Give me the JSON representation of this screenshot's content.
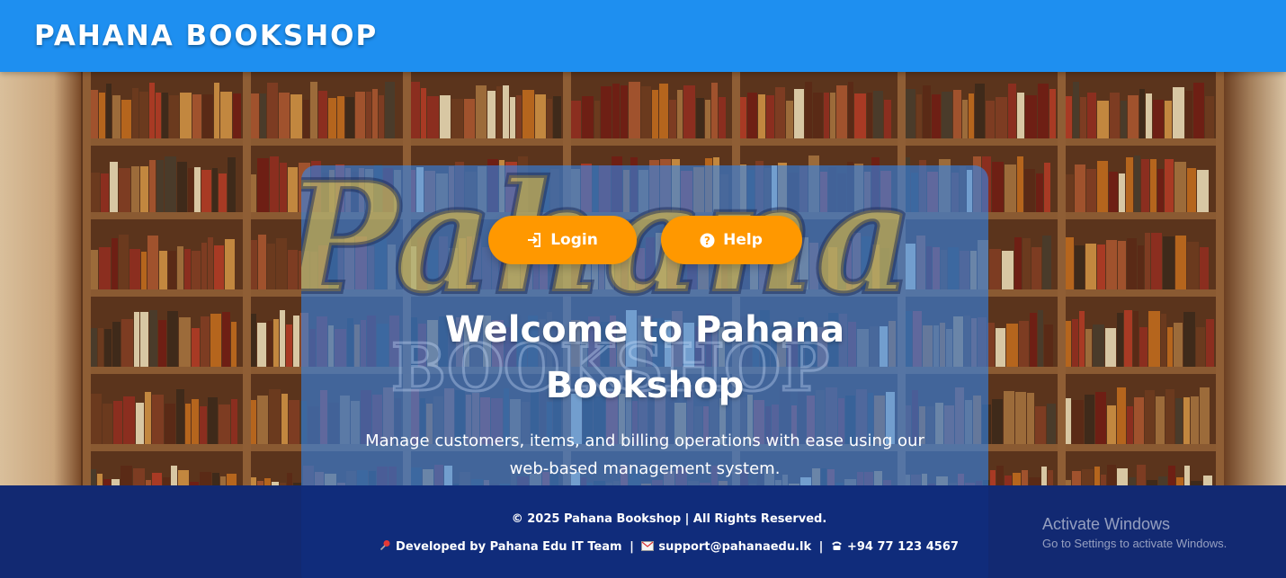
{
  "header": {
    "brand": "PAHANA BOOKSHOP"
  },
  "hero": {
    "logo_text": "Pahana",
    "logo_subtext": "BOOKSHOP",
    "actions": {
      "login_label": "Login",
      "help_label": "Help"
    },
    "title": "Welcome to Pahana Bookshop",
    "description": "Manage customers, items, and billing operations with ease using our web-based management system."
  },
  "footer": {
    "copyright": "© 2025 Pahana Bookshop | All Rights Reserved.",
    "developer": "Developed by Pahana Edu IT Team",
    "email": "support@pahanaedu.lk",
    "phone": "+94 77 123 4567",
    "separator": "|"
  },
  "watermark": {
    "title": "Activate Windows",
    "subtitle": "Go to Settings to activate Windows."
  },
  "colors": {
    "header_bg": "#1e8ff0",
    "button_accent": "#ff9800",
    "footer_bg": "#0c2878",
    "text": "#ffffff"
  },
  "icons": {
    "login": "sign-in-icon",
    "help": "question-circle-icon",
    "developer": "pushpin-icon",
    "email": "envelope-icon",
    "phone": "telephone-icon"
  }
}
